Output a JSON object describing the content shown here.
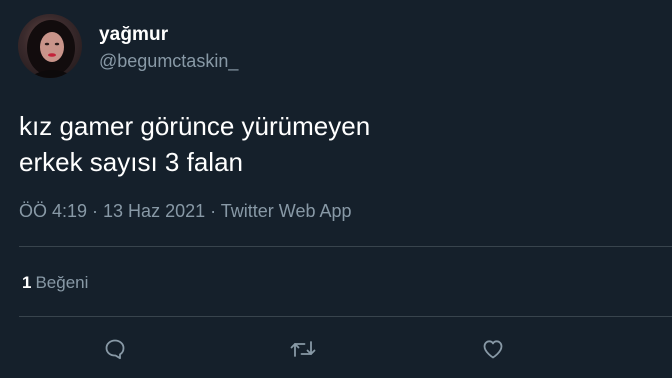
{
  "tweet": {
    "display_name": "yağmur",
    "handle": "@begumctaskin_",
    "text_lines": [
      "kız gamer görünce yürümeyen",
      "erkek sayısı 3 falan"
    ],
    "meta": "ÖÖ 4:19 · 13 Haz 2021 · Twitter Web App",
    "likes": {
      "count": "1",
      "label": "Beğeni"
    }
  },
  "icons": {
    "reply": "reply-icon",
    "retweet": "retweet-icon",
    "like": "heart-icon"
  },
  "colors": {
    "background": "#15202b",
    "text_primary": "#ffffff",
    "text_secondary": "#8899a6",
    "divider": "#38444d"
  }
}
